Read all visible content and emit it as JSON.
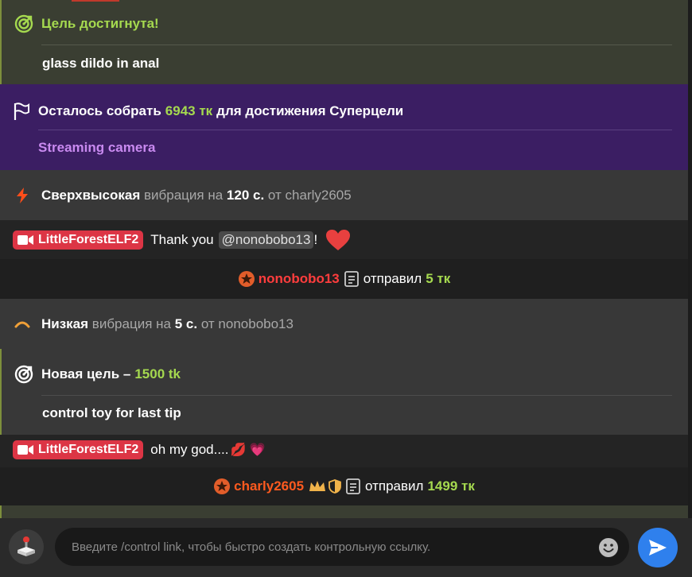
{
  "goal_reached": {
    "title": "Цель достигнута!",
    "description": "glass dildo in anal"
  },
  "supergoal": {
    "prefix": "Осталось собрать",
    "amount": "6943 тк",
    "suffix": "для достижения Суперцели",
    "item": "Streaming camera"
  },
  "vibration_1": {
    "level": "Сверхвысокая",
    "word": "вибрация на",
    "duration": "120 с.",
    "from_word": "от",
    "user": "charly2605"
  },
  "message_1": {
    "user": "LittleForestELF2",
    "text_before": "Thank you",
    "mention": "@nonobobo13",
    "text_after": "!"
  },
  "tip_1": {
    "user": "nonobobo13",
    "verb": "отправил",
    "amount": "5 тк"
  },
  "vibration_2": {
    "level": "Низкая",
    "word": "вибрация на",
    "duration": "5 с.",
    "from_word": "от",
    "user": "nonobobo13"
  },
  "new_goal": {
    "title": "Новая цель –",
    "amount": "1500 tk",
    "description": "control toy for last tip"
  },
  "message_2": {
    "user": "LittleForestELF2",
    "text": "oh my god....",
    "emojis": "💋 💗"
  },
  "tip_2": {
    "user": "charly2605",
    "verb": "отправил",
    "amount": "1499 тк"
  },
  "composer": {
    "placeholder": "Введите /control link, чтобы быстро создать контрольную ссылку."
  },
  "colors": {
    "accent_green": "#a5d94f",
    "supergoal_purple": "#3b1e63",
    "badge_red": "#dc3545",
    "send_blue": "#2f80ed"
  }
}
